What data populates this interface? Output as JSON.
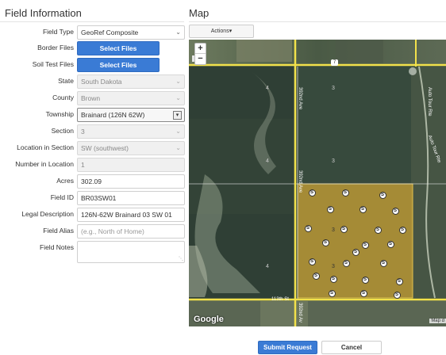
{
  "titles": {
    "field_information": "Field Information",
    "map": "Map"
  },
  "form": {
    "field_type": {
      "label": "Field Type",
      "value": "GeoRef Composite"
    },
    "border_files": {
      "label": "Border Files",
      "button": "Select Files"
    },
    "soil_test_files": {
      "label": "Soil Test Files",
      "button": "Select Files"
    },
    "state": {
      "label": "State",
      "value": "South Dakota"
    },
    "county": {
      "label": "County",
      "value": "Brown"
    },
    "township": {
      "label": "Township",
      "value": "Brainard (126N 62W)"
    },
    "section": {
      "label": "Section",
      "value": "3"
    },
    "location_in_section": {
      "label": "Location in Section",
      "value": "SW (southwest)"
    },
    "number_in_location": {
      "label": "Number in Location",
      "value": "1"
    },
    "acres": {
      "label": "Acres",
      "value": "302.09"
    },
    "field_id": {
      "label": "Field ID",
      "value": "BR03SW01"
    },
    "legal_description": {
      "label": "Legal Description",
      "value": "126N-62W Brainard 03 SW 01"
    },
    "field_alias": {
      "label": "Field Alias",
      "placeholder": "(e.g., North of Home)"
    },
    "field_notes": {
      "label": "Field Notes",
      "value": ""
    }
  },
  "map": {
    "actions_label": "Actions",
    "zoom_in": "+",
    "zoom_out": "−",
    "google_logo": "Google",
    "map_data_label": "Map d",
    "road_labels": {
      "top_left": "12",
      "top_shield": "7",
      "avenue_top": "392nd Ave",
      "avenue_mid": "392nd Ave",
      "avenue_bottom": "392nd Av",
      "street_bottom": "113th St",
      "auto_tour_top": "Auto Tour Rte",
      "auto_tour_mid": "Auto Tour Rte"
    },
    "section_numbers": [
      "4",
      "3",
      "4",
      "3",
      "4",
      "3",
      "3"
    ],
    "sample_marker_label": "S",
    "sample_count": 24,
    "field_color": "#c9a234"
  },
  "footer": {
    "submit": "Submit Request",
    "cancel": "Cancel"
  },
  "colors": {
    "accent": "#3a7bd5",
    "road": "#f2e14b",
    "parcel_line": "#e8e8e8"
  }
}
